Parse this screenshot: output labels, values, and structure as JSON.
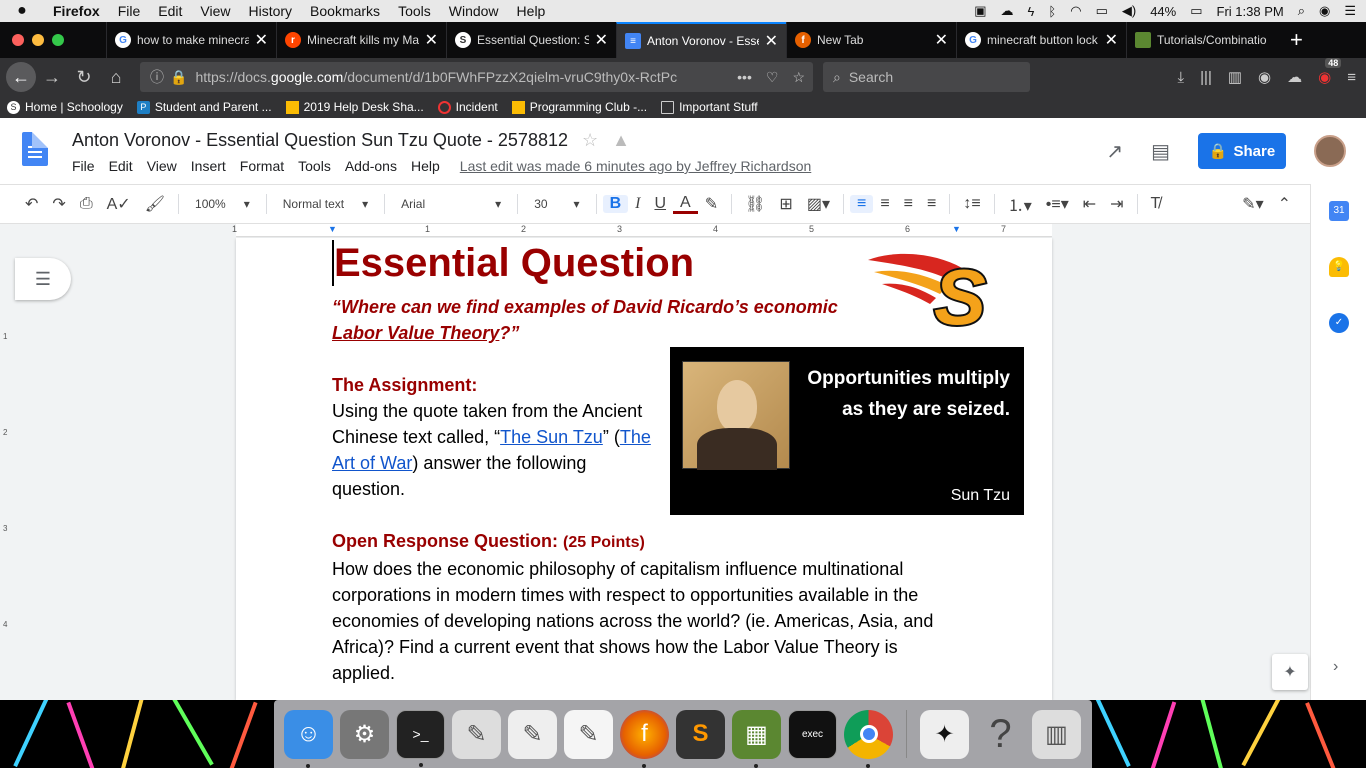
{
  "macmenu": {
    "app": "Firefox",
    "items": [
      "File",
      "Edit",
      "View",
      "History",
      "Bookmarks",
      "Tools",
      "Window",
      "Help"
    ],
    "battery": "44%",
    "clock": "Fri 1:38 PM"
  },
  "tabs": [
    {
      "label": "how to make minecra",
      "icon": "google-icon",
      "color": "#fff"
    },
    {
      "label": "Minecraft kills my Ma",
      "icon": "reddit-icon",
      "color": "#ff4500"
    },
    {
      "label": "Essential Question: S",
      "icon": "schoology-icon",
      "color": "#2e2e2e"
    },
    {
      "label": "Anton Voronov - Esse",
      "icon": "docs-icon",
      "color": "#4285f4"
    },
    {
      "label": "New Tab",
      "icon": "firefox-icon",
      "color": "#e66000"
    },
    {
      "label": "minecraft button lock",
      "icon": "google-icon",
      "color": "#fff"
    },
    {
      "label": "Tutorials/Combinatio",
      "icon": "minecraft-icon",
      "color": "#5b8731"
    }
  ],
  "url": {
    "prefix": "https://docs.",
    "host": "google.com",
    "path": "/document/d/1b0FWhFPzzX2qielm-vruC9thy0x-RctPc"
  },
  "search_placeholder": "Search",
  "notification_count": "48",
  "bookmarks": [
    {
      "label": "Home | Schoology",
      "icon": "schoology-icon"
    },
    {
      "label": "Student and Parent ...",
      "icon": "parent-portal-icon"
    },
    {
      "label": "2019 Help Desk Sha...",
      "icon": "drive-icon"
    },
    {
      "label": "Incident",
      "icon": "incident-icon"
    },
    {
      "label": "Programming Club -...",
      "icon": "drive-icon"
    },
    {
      "label": "Important Stuff",
      "icon": "folder-icon"
    }
  ],
  "doc": {
    "title": "Anton Voronov - Essential Question Sun Tzu Quote - 2578812",
    "menu": [
      "File",
      "Edit",
      "View",
      "Insert",
      "Format",
      "Tools",
      "Add-ons",
      "Help"
    ],
    "last_edit": "Last edit was made 6 minutes ago by Jeffrey Richardson",
    "share_label": "Share"
  },
  "toolbar": {
    "zoom": "100%",
    "style": "Normal text",
    "font": "Arial",
    "size": "30"
  },
  "ruler_marks": [
    "1",
    "1",
    "2",
    "3",
    "4",
    "5",
    "6",
    "7"
  ],
  "vruler_marks": [
    "1",
    "2",
    "3",
    "4"
  ],
  "content": {
    "heading": "Essential Question",
    "question_part1": "“Where can we find examples of David Ricardo’s economic ",
    "question_part2": "Labor Value Theory",
    "question_part3": "?”",
    "assignment_heading": "The Assignment:",
    "assignment_text1": "Using the quote taken from the Ancient Chinese text called, “",
    "assignment_link1": "The Sun Tzu",
    "assignment_text2": "” (",
    "assignment_link2": "The Art of War",
    "assignment_text3": ") answer the following question.",
    "orq_heading": "Open Response Question: ",
    "orq_points": "(25 Points)",
    "orq_text": "How does the economic philosophy of capitalism influence multinational corporations in modern times with respect to opportunities available in the economies of developing nations across the world? (ie. Americas, Asia, and Africa)? Find a current event that shows how the Labor Value Theory is applied.",
    "logo_letter": "S",
    "quote": "Opportunities multiply as they are seized.",
    "quote_author": "Sun Tzu"
  },
  "dock": [
    {
      "name": "finder-icon",
      "color": "#3a8ee6",
      "glyph": "☺"
    },
    {
      "name": "system-preferences-icon",
      "color": "#777",
      "glyph": "⚙"
    },
    {
      "name": "terminal-icon",
      "color": "#222",
      "glyph": ">_"
    },
    {
      "name": "script-editor-icon",
      "color": "#ddd",
      "glyph": "✎"
    },
    {
      "name": "textedit-icon",
      "color": "#eee",
      "glyph": "✎"
    },
    {
      "name": "notes-icon",
      "color": "#f5f5f5",
      "glyph": "✎"
    },
    {
      "name": "firefox-icon",
      "color": "#e66000",
      "glyph": "🦊"
    },
    {
      "name": "sublime-text-icon",
      "color": "#333",
      "glyph": "S"
    },
    {
      "name": "minecraft-icon",
      "color": "#5b8731",
      "glyph": "▦"
    },
    {
      "name": "exec-icon",
      "color": "#111",
      "glyph": "exec"
    },
    {
      "name": "chrome-icon",
      "color": "#fff",
      "glyph": "◉"
    },
    {
      "name": "preview-icon",
      "color": "#eee",
      "glyph": "✦"
    },
    {
      "name": "help-icon",
      "color": "#aaa",
      "glyph": "?"
    },
    {
      "name": "trash-icon",
      "color": "#ddd",
      "glyph": "🗑"
    }
  ]
}
